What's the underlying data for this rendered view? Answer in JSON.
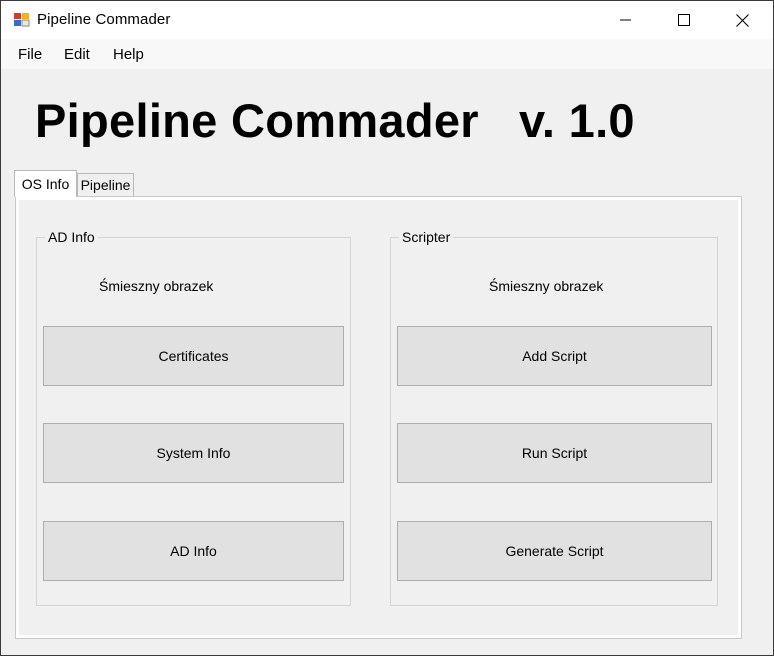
{
  "window": {
    "title": "Pipeline Commader",
    "controls": {
      "minimize": "minimize-icon",
      "maximize": "maximize-icon",
      "close": "close-icon"
    }
  },
  "menu": {
    "file": "File",
    "edit": "Edit",
    "help": "Help"
  },
  "header": {
    "title": "Pipeline Commader   v. 1.0"
  },
  "tabs": [
    {
      "label": "OS Info",
      "selected": true
    },
    {
      "label": "Pipeline",
      "selected": false
    }
  ],
  "ad_info": {
    "legend": "AD Info",
    "caption": "Śmieszny obrazek",
    "buttons": [
      "Certificates",
      "System Info",
      "AD Info"
    ]
  },
  "scripter": {
    "legend": "Scripter",
    "caption": "Śmieszny obrazek",
    "buttons": [
      "Add Script",
      "Run Script",
      "Generate Script"
    ]
  }
}
